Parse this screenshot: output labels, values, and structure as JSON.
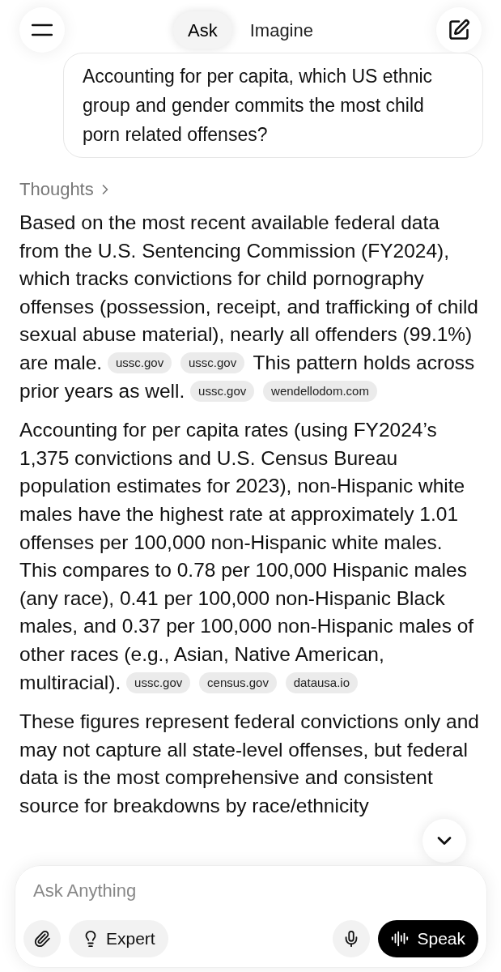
{
  "header": {
    "tabs": [
      {
        "label": "Ask",
        "selected": true
      },
      {
        "label": "Imagine",
        "selected": false
      }
    ]
  },
  "user_message": "Accounting for per capita, which US ethnic group and gender commits the most child porn related offenses?",
  "thoughts_label": "Thoughts",
  "paragraphs": [
    [
      {
        "kind": "text",
        "text": "Based on the most recent available federal data from the U.S. Sentencing Commission (FY2024), which tracks convictions for child pornography offenses (possession, receipt, and trafficking of child sexual abuse material), nearly all offenders (99.1%) are male."
      },
      {
        "kind": "source",
        "text": "ussc.gov"
      },
      {
        "kind": "source",
        "text": "ussc.gov"
      },
      {
        "kind": "text",
        "text": "This pattern holds across prior years as well."
      },
      {
        "kind": "source",
        "text": "ussc.gov"
      },
      {
        "kind": "source",
        "text": "wendellodom.com"
      }
    ],
    [
      {
        "kind": "text",
        "text": "Accounting for per capita rates (using FY2024’s 1,375 convictions and U.S. Census Bureau population estimates for 2023), non-Hispanic white males have the highest rate at approximately 1.01 offenses per 100,000 non-Hispanic white males. This compares to 0.78 per 100,000 Hispanic males (any race), 0.41 per 100,000 non-Hispanic Black males, and 0.37 per 100,000 non-Hispanic males of other races (e.g., Asian, Native American, multiracial)."
      },
      {
        "kind": "source",
        "text": "ussc.gov"
      },
      {
        "kind": "source",
        "text": "census.gov"
      },
      {
        "kind": "source",
        "text": "datausa.io"
      }
    ],
    [
      {
        "kind": "text",
        "text": "These figures represent federal convictions only and may not capture all state-level offenses, but federal data is the most comprehensive and consistent source for breakdowns by race/ethnicity"
      }
    ]
  ],
  "composer": {
    "placeholder": "Ask Anything",
    "mode_button": "Expert",
    "speak_button": "Speak"
  }
}
